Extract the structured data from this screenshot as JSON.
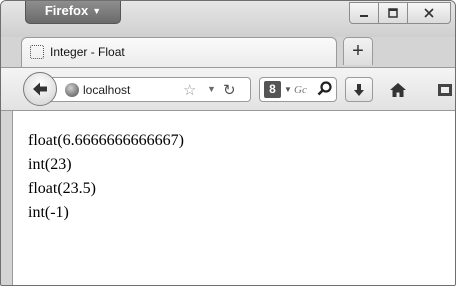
{
  "app_menu": {
    "label": "Firefox",
    "icon": "chevron-down-icon"
  },
  "window_controls": [
    {
      "name": "minimize",
      "icon": "minimize-icon"
    },
    {
      "name": "maximize",
      "icon": "maximize-icon"
    },
    {
      "name": "close",
      "icon": "close-icon"
    }
  ],
  "tab": {
    "title": "Integer - Float",
    "favicon": "blank-page-icon"
  },
  "new_tab": {
    "label": "+"
  },
  "navbar": {
    "url": "localhost",
    "search_placeholder": "Gc",
    "search_engine": "8"
  },
  "content": {
    "lines": [
      "float(6.6666666666667)",
      "int(23)",
      "float(23.5)",
      "int(-1)"
    ]
  }
}
